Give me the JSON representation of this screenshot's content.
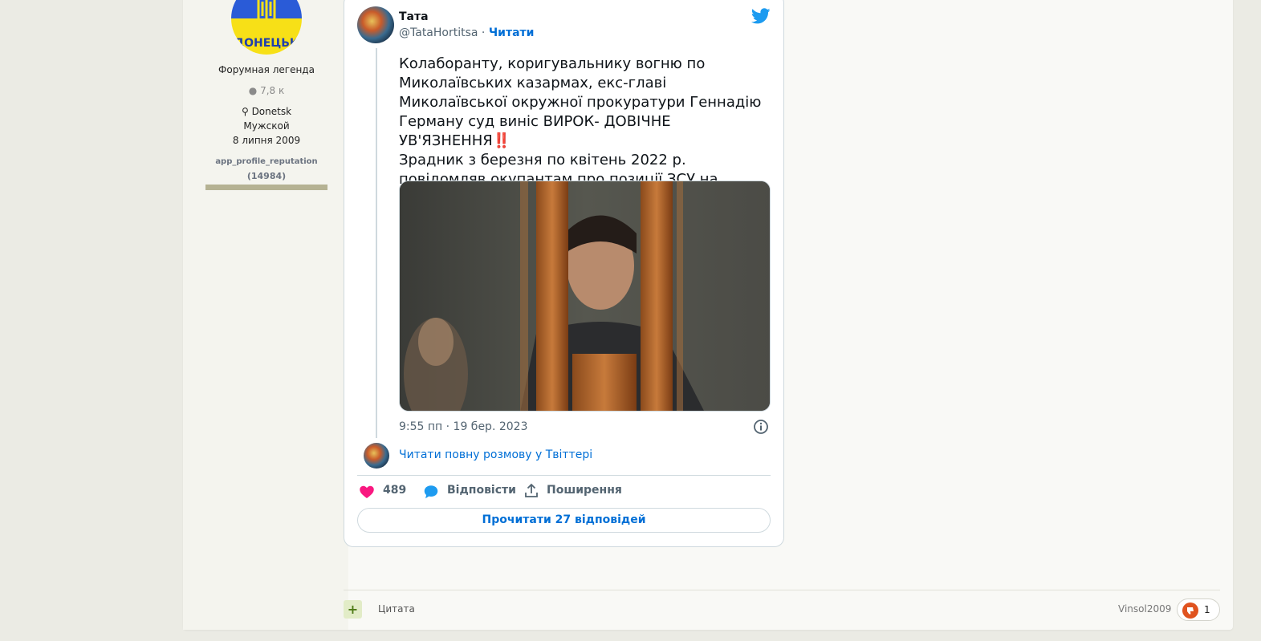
{
  "author": {
    "avatar_text": "ДОНЕЦЬК",
    "rank": "Форумная легенда",
    "posts_count": "7,8 к",
    "location": "Donetsk",
    "gender": "Мужской",
    "joined": "8 липня 2009",
    "reputation_label": "app_profile_reputation",
    "reputation_value": "(14984)",
    "avatar_colors": {
      "top": "#2a5bd7",
      "bottom": "#f7e017"
    }
  },
  "tweet": {
    "name": "Тата",
    "handle": "@TataHortitsa",
    "separator": " · ",
    "follow_label": "Читати",
    "text": "Колаборанту, коригувальнику вогню по Миколаївських казармах, екс-главі Миколаївської окружної прокуратури Геннадію Герману суд виніс ВИРОК- ДОВІЧНЕ УВ'ЯЗНЕННЯ‼️\nЗрадник з березня по квітень 2022 р. повідомляв окупантам про позиції ЗСУ на Миколаївщині⤵️",
    "time": "9:55 пп · 19 бер. 2023",
    "read_conversation": "Читати повну розмову у Твіттері",
    "likes": "489",
    "reply_label": "Відповісти",
    "share_label": "Поширення",
    "read_replies": "Прочитати 27 відповідей",
    "bird_color": "#1d9bf0",
    "heart_color": "#f91880"
  },
  "footer": {
    "plus": "+",
    "quote_label": "Цитата",
    "reactor": "Vinsol2009",
    "reaction_count": "1"
  }
}
